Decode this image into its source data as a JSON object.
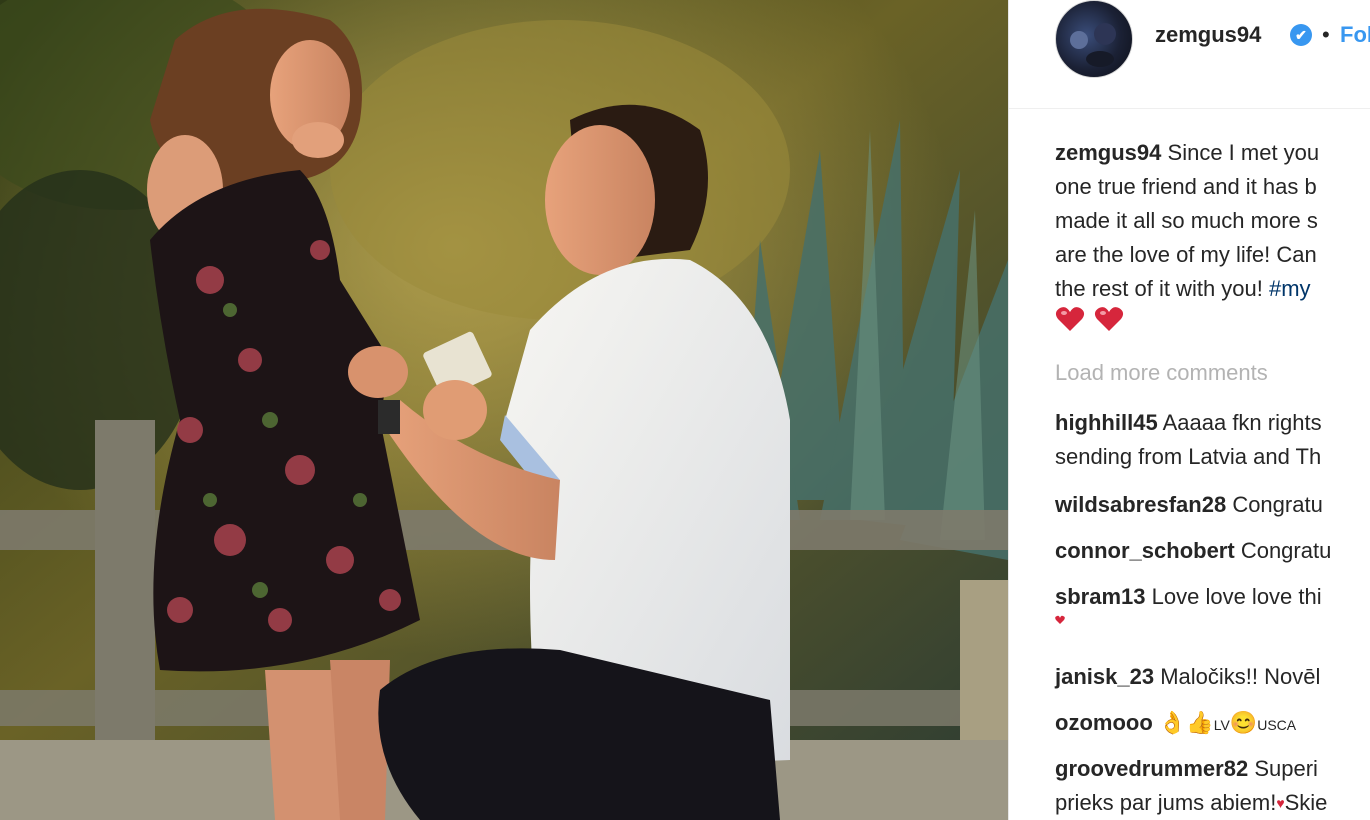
{
  "post": {
    "username": "zemgus94",
    "follow_label": "Fol",
    "separator": "•",
    "verified_glyph": "✔",
    "caption": {
      "user": "zemgus94",
      "lines": [
        "Since I met you",
        "one true friend and it has b",
        "made it all so much more s",
        "are the love of my life! Can",
        "the rest of it with you! "
      ],
      "hashtag": "#my"
    },
    "caption_emoji": [
      "heart-emoji",
      "heart-emoji"
    ],
    "load_more_label": "Load more comments"
  },
  "comments": [
    {
      "user": "highhill45",
      "text": "Aaaaa fkn rights",
      "text2": "sending from Latvia and Th"
    },
    {
      "user": "wildsabresfan28",
      "text": "Congratu"
    },
    {
      "user": "connor_schobert",
      "text": "Congratu"
    },
    {
      "user": "sbram13",
      "text": "Love love love thi"
    },
    {
      "user": "janisk_23",
      "text": "Maločiks!! Novēl"
    },
    {
      "user": "ozomooo",
      "text_parts": [
        "👌",
        "👍",
        "LV",
        "😊",
        "USCA"
      ]
    },
    {
      "user": "groovedrummer82",
      "text": "Superi",
      "text2": "prieks par jums abiem!",
      "text2_tail": "Skie"
    }
  ],
  "colors": {
    "link": "#3897f0",
    "text": "#262626",
    "muted": "#b3b3b3",
    "heart": "#e0245e",
    "hashtag": "#003569"
  }
}
